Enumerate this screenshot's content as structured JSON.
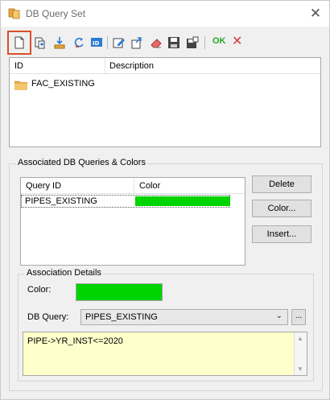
{
  "window": {
    "title": "DB Query Set"
  },
  "toolbar": {
    "ok_label": "OK",
    "cancel_label": "✕"
  },
  "top_list": {
    "columns": [
      "ID",
      "Description"
    ],
    "items": [
      {
        "id": "FAC_EXISTING",
        "description": ""
      }
    ]
  },
  "associated": {
    "group_title": "Associated DB Queries & Colors",
    "columns": [
      "Query ID",
      "Color"
    ],
    "rows": [
      {
        "query_id": "PIPES_EXISTING",
        "color": "#00d400"
      }
    ],
    "buttons": {
      "delete": "Delete",
      "color": "Color...",
      "insert": "Insert..."
    }
  },
  "details": {
    "group_title": "Association Details",
    "color_label": "Color:",
    "color_value": "#00d400",
    "query_label": "DB Query:",
    "query_value": "PIPES_EXISTING",
    "ellipsis": "...",
    "expression": "PIPE->YR_INST<=2020"
  },
  "colors": {
    "highlight": "#d9502a",
    "swatch": "#00d400",
    "expression_bg": "#ffffcc"
  }
}
